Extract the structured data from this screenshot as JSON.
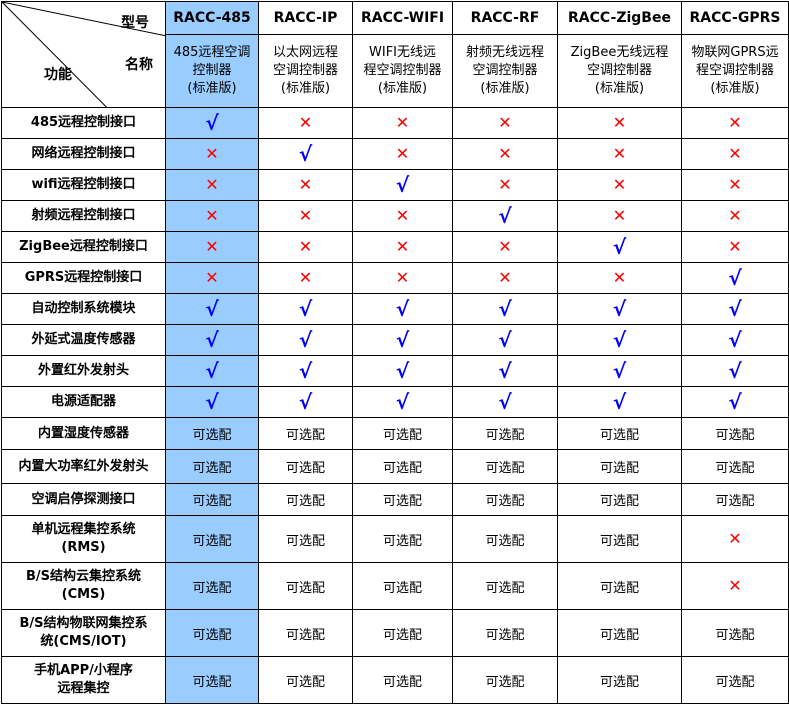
{
  "header": {
    "model_label": "型号",
    "name_label": "名称",
    "function_label": "功能",
    "models": [
      "RACC-485",
      "RACC-IP",
      "RACC-WIFI",
      "RACC-RF",
      "RACC-ZigBee",
      "RACC-GPRS"
    ],
    "names": [
      [
        "485远程空调",
        "控制器",
        "(标准版)"
      ],
      [
        "以太网远程",
        "空调控制器",
        "(标准版)"
      ],
      [
        "WIFI无线远",
        "程空调控制器",
        "(标准版)"
      ],
      [
        "射频无线远程",
        "空调控制器",
        "(标准版)"
      ],
      [
        "ZigBee无线远程",
        "空调控制器",
        "(标准版)"
      ],
      [
        "物联网GPRS远",
        "程空调控制器",
        "(标准版)"
      ]
    ]
  },
  "symbols": {
    "check": "√",
    "cross": "✕",
    "optional": "可选配"
  },
  "colors": {
    "highlight": "#99ccff",
    "check": "#0000ff",
    "cross": "#ff0000"
  },
  "rows": [
    {
      "label": [
        "485远程控制接口"
      ],
      "values": [
        "check",
        "cross",
        "cross",
        "cross",
        "cross",
        "cross"
      ]
    },
    {
      "label": [
        "网络远程控制接口"
      ],
      "values": [
        "cross",
        "check",
        "cross",
        "cross",
        "cross",
        "cross"
      ]
    },
    {
      "label": [
        "wifi远程控制接口"
      ],
      "values": [
        "cross",
        "cross",
        "check",
        "cross",
        "cross",
        "cross"
      ]
    },
    {
      "label": [
        "射频远程控制接口"
      ],
      "values": [
        "cross",
        "cross",
        "cross",
        "check",
        "cross",
        "cross"
      ]
    },
    {
      "label": [
        "ZigBee远程控制接口"
      ],
      "values": [
        "cross",
        "cross",
        "cross",
        "cross",
        "check",
        "cross"
      ]
    },
    {
      "label": [
        "GPRS远程控制接口"
      ],
      "values": [
        "cross",
        "cross",
        "cross",
        "cross",
        "cross",
        "check"
      ]
    },
    {
      "label": [
        "自动控制系统模块"
      ],
      "values": [
        "check",
        "check",
        "check",
        "check",
        "check",
        "check"
      ]
    },
    {
      "label": [
        "外延式温度传感器"
      ],
      "values": [
        "check",
        "check",
        "check",
        "check",
        "check",
        "check"
      ]
    },
    {
      "label": [
        "外置红外发射头"
      ],
      "values": [
        "check",
        "check",
        "check",
        "check",
        "check",
        "check"
      ]
    },
    {
      "label": [
        "电源适配器"
      ],
      "values": [
        "check",
        "check",
        "check",
        "check",
        "check",
        "check"
      ]
    },
    {
      "label": [
        "内置湿度传感器"
      ],
      "values": [
        "optional",
        "optional",
        "optional",
        "optional",
        "optional",
        "optional"
      ]
    },
    {
      "label": [
        "内置大功率红外发射头"
      ],
      "values": [
        "optional",
        "optional",
        "optional",
        "optional",
        "optional",
        "optional"
      ]
    },
    {
      "label": [
        "空调启停探测接口"
      ],
      "values": [
        "optional",
        "optional",
        "optional",
        "optional",
        "optional",
        "optional"
      ]
    },
    {
      "label": [
        "单机远程集控系统",
        "(RMS)"
      ],
      "values": [
        "optional",
        "optional",
        "optional",
        "optional",
        "optional",
        "cross"
      ]
    },
    {
      "label": [
        "B/S结构云集控系统",
        "(CMS)"
      ],
      "values": [
        "optional",
        "optional",
        "optional",
        "optional",
        "optional",
        "cross"
      ]
    },
    {
      "label": [
        "B/S结构物联网集控系",
        "统(CMS/IOT)"
      ],
      "values": [
        "optional",
        "optional",
        "optional",
        "optional",
        "optional",
        "optional"
      ]
    },
    {
      "label": [
        "手机APP/小程序",
        "远程集控"
      ],
      "values": [
        "optional",
        "optional",
        "optional",
        "optional",
        "optional",
        "optional"
      ]
    }
  ]
}
